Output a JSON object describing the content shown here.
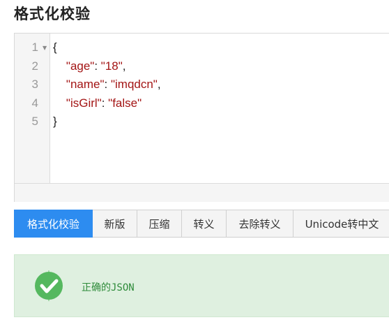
{
  "title": "格式化校验",
  "editor": {
    "line_numbers": [
      "1",
      "2",
      "3",
      "4",
      "5"
    ],
    "lines": [
      {
        "indent": "",
        "key": "",
        "sep": "",
        "value": "",
        "tail": "{"
      },
      {
        "indent": "    ",
        "key": "\"age\"",
        "sep": ": ",
        "value": "\"18\"",
        "tail": ","
      },
      {
        "indent": "    ",
        "key": "\"name\"",
        "sep": ": ",
        "value": "\"imqdcn\"",
        "tail": ","
      },
      {
        "indent": "    ",
        "key": "\"isGirl\"",
        "sep": ": ",
        "value": "\"false\"",
        "tail": ""
      },
      {
        "indent": "",
        "key": "",
        "sep": "",
        "value": "",
        "tail": "}"
      }
    ]
  },
  "toolbar": {
    "buttons": [
      "格式化校验",
      "新版",
      "压缩",
      "转义",
      "去除转义",
      "Unicode转中文"
    ]
  },
  "result": {
    "message": "正确的JSON",
    "icon": "check-circle-icon",
    "color": "#2e8b3a"
  }
}
